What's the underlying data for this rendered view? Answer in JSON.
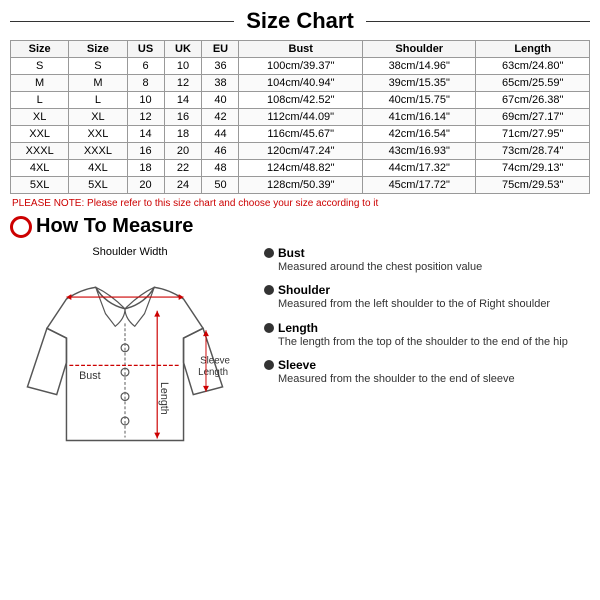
{
  "title": "Size Chart",
  "table": {
    "headers": [
      "Size",
      "Size",
      "US",
      "UK",
      "EU",
      "Bust",
      "Shoulder",
      "Length"
    ],
    "rows": [
      [
        "S",
        "S",
        "6",
        "10",
        "36",
        "100cm/39.37\"",
        "38cm/14.96\"",
        "63cm/24.80\""
      ],
      [
        "M",
        "M",
        "8",
        "12",
        "38",
        "104cm/40.94\"",
        "39cm/15.35\"",
        "65cm/25.59\""
      ],
      [
        "L",
        "L",
        "10",
        "14",
        "40",
        "108cm/42.52\"",
        "40cm/15.75\"",
        "67cm/26.38\""
      ],
      [
        "XL",
        "XL",
        "12",
        "16",
        "42",
        "112cm/44.09\"",
        "41cm/16.14\"",
        "69cm/27.17\""
      ],
      [
        "XXL",
        "XXL",
        "14",
        "18",
        "44",
        "116cm/45.67\"",
        "42cm/16.54\"",
        "71cm/27.95\""
      ],
      [
        "XXXL",
        "XXXL",
        "16",
        "20",
        "46",
        "120cm/47.24\"",
        "43cm/16.93\"",
        "73cm/28.74\""
      ],
      [
        "4XL",
        "4XL",
        "18",
        "22",
        "48",
        "124cm/48.82\"",
        "44cm/17.32\"",
        "74cm/29.13\""
      ],
      [
        "5XL",
        "5XL",
        "20",
        "24",
        "50",
        "128cm/50.39\"",
        "45cm/17.72\"",
        "75cm/29.53\""
      ]
    ]
  },
  "note": "PLEASE NOTE: Please refer to this size chart and choose your size according to it",
  "how_to_measure": {
    "title": "How To Measure",
    "diagram": {
      "shoulder_width_label": "Shoulder Width",
      "bust_label": "Bust",
      "sleeve_length_label": "Sleeve\nLength",
      "length_label": "Length"
    },
    "items": [
      {
        "title": "Bust",
        "desc": "Measured around the chest position value"
      },
      {
        "title": "Shoulder",
        "desc": "Measured from the left shoulder to the of Right shoulder"
      },
      {
        "title": "Length",
        "desc": "The length from the top of the shoulder to the end of the hip"
      },
      {
        "title": "Sleeve",
        "desc": "Measured from the shoulder to the end of sleeve"
      }
    ]
  }
}
